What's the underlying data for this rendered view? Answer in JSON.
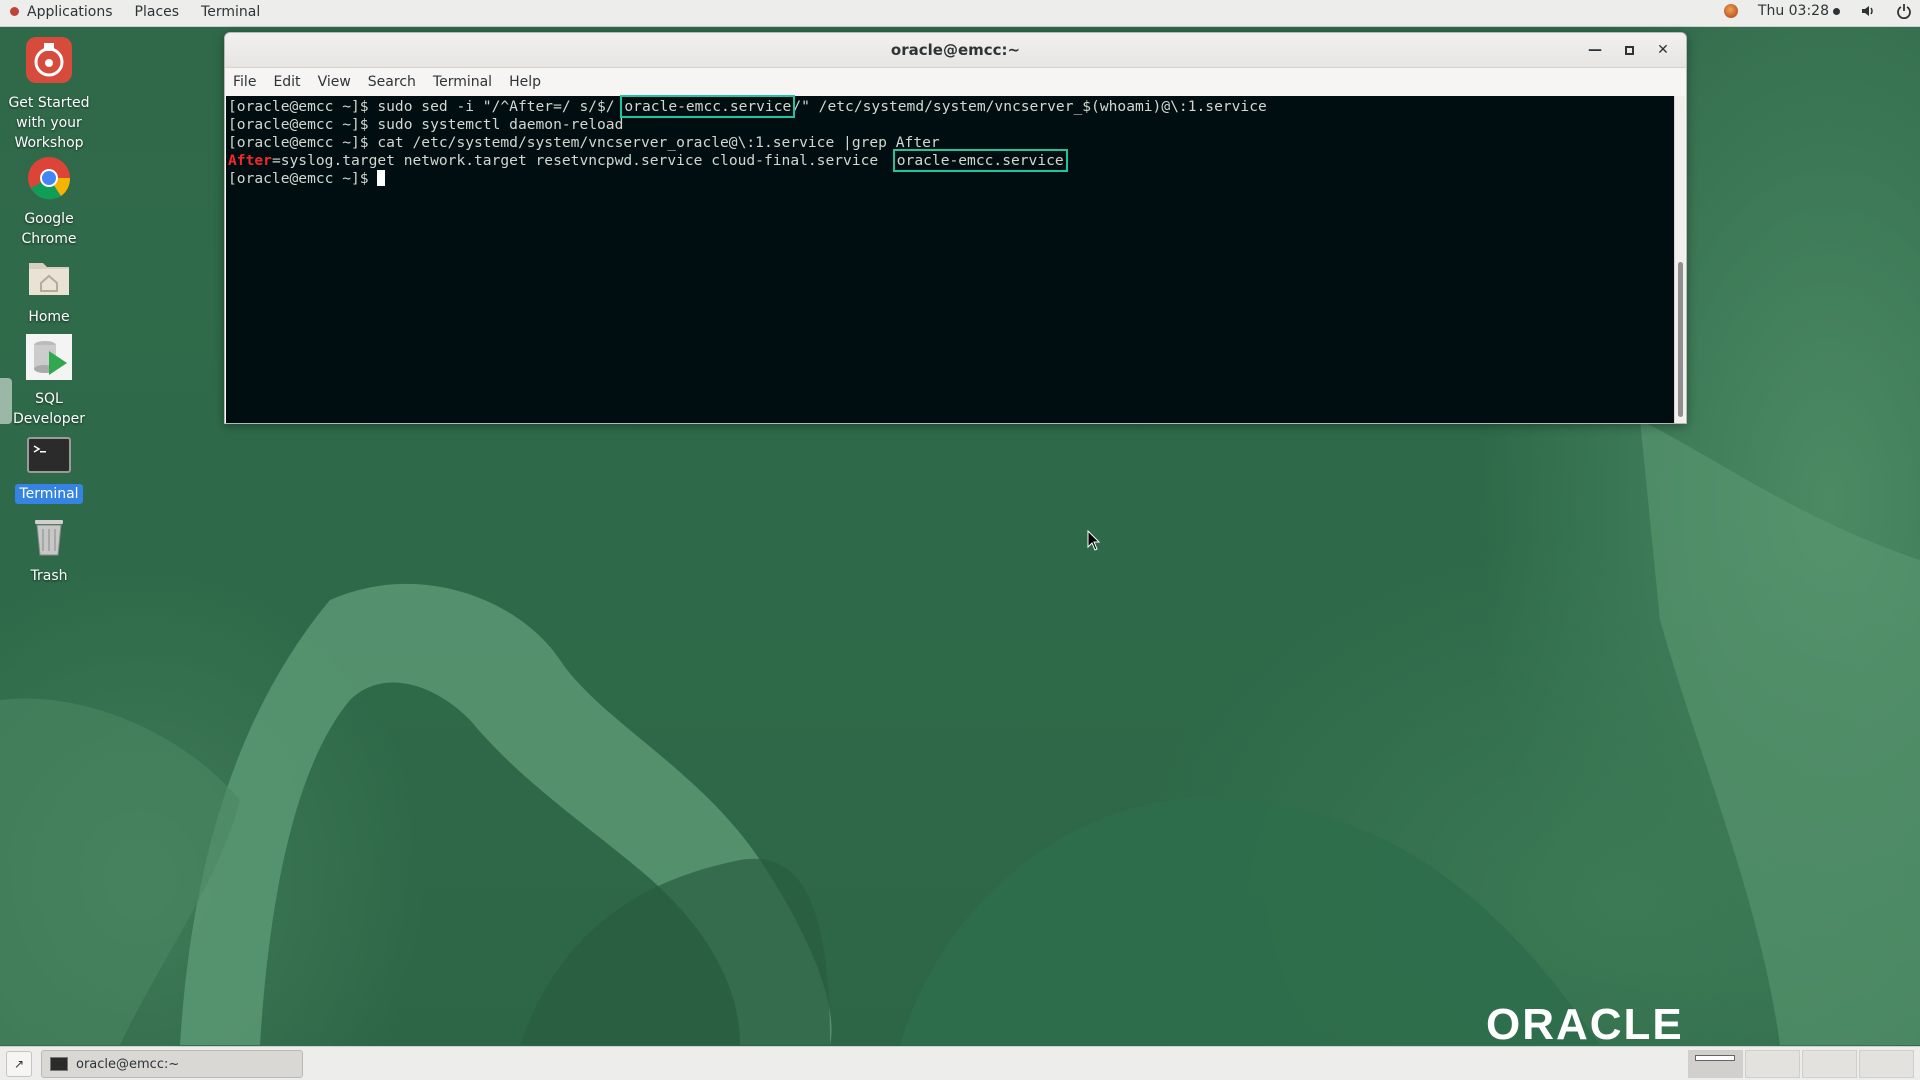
{
  "topbar": {
    "applications": "Applications",
    "places": "Places",
    "terminal": "Terminal",
    "clock": "Thu 03:28",
    "icons": [
      "status-indicator-icon",
      "volume-icon",
      "power-icon"
    ]
  },
  "desktop_icons": [
    {
      "name": "get-started",
      "label": "Get Started with your Workshop"
    },
    {
      "name": "google-chrome",
      "label": "Google Chrome"
    },
    {
      "name": "home",
      "label": "Home"
    },
    {
      "name": "sql-developer",
      "label": "SQL Developer"
    },
    {
      "name": "terminal",
      "label": "Terminal"
    },
    {
      "name": "trash",
      "label": "Trash"
    }
  ],
  "terminal_window": {
    "title": "oracle@emcc:~",
    "menu": [
      "File",
      "Edit",
      "View",
      "Search",
      "Terminal",
      "Help"
    ],
    "lines": {
      "l1_pre": "[oracle@emcc ~]$ sudo sed -i \"/^After=/ s/$/ ",
      "l1_hl": "oracle-emcc.service",
      "l1_post": "/\" /etc/systemd/system/vncserver_$(whoami)@\\:1.service",
      "l2": "[oracle@emcc ~]$ sudo systemctl daemon-reload",
      "l3": "[oracle@emcc ~]$ cat /etc/systemd/system/vncserver_oracle@\\:1.service |grep After",
      "l4_red": "After",
      "l4_mid": "=syslog.target network.target resetvncpwd.service cloud-final.service  ",
      "l4_hl": "oracle-emcc.service",
      "l5": "[oracle@emcc ~]$ "
    },
    "highlight_color": "#1ec6a0"
  },
  "branding": {
    "logo_text": "ORACLE"
  },
  "taskbar": {
    "task_label": "oracle@emcc:~",
    "workspaces": 4
  }
}
